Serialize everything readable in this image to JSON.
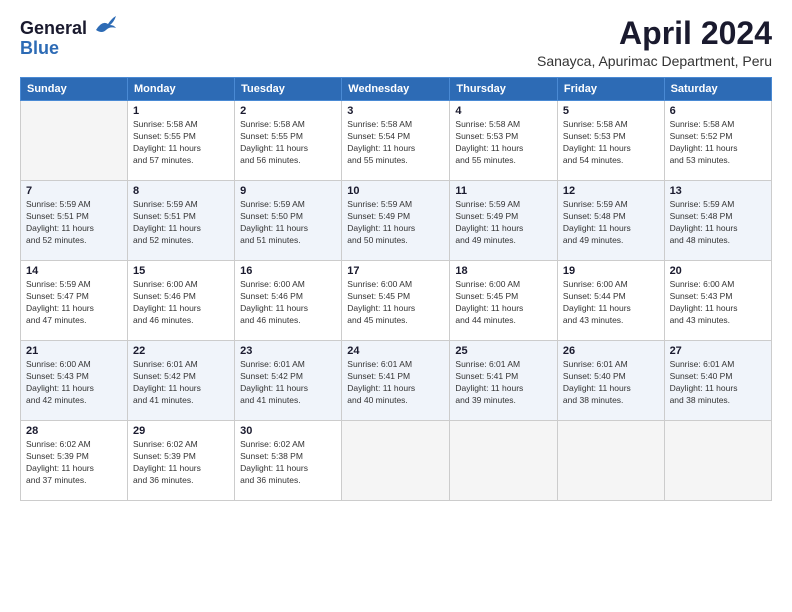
{
  "logo": {
    "general": "General",
    "blue": "Blue"
  },
  "title": {
    "month_year": "April 2024",
    "location": "Sanayca, Apurimac Department, Peru"
  },
  "headers": [
    "Sunday",
    "Monday",
    "Tuesday",
    "Wednesday",
    "Thursday",
    "Friday",
    "Saturday"
  ],
  "weeks": [
    [
      {
        "day": "",
        "info": ""
      },
      {
        "day": "1",
        "info": "Sunrise: 5:58 AM\nSunset: 5:55 PM\nDaylight: 11 hours\nand 57 minutes."
      },
      {
        "day": "2",
        "info": "Sunrise: 5:58 AM\nSunset: 5:55 PM\nDaylight: 11 hours\nand 56 minutes."
      },
      {
        "day": "3",
        "info": "Sunrise: 5:58 AM\nSunset: 5:54 PM\nDaylight: 11 hours\nand 55 minutes."
      },
      {
        "day": "4",
        "info": "Sunrise: 5:58 AM\nSunset: 5:53 PM\nDaylight: 11 hours\nand 55 minutes."
      },
      {
        "day": "5",
        "info": "Sunrise: 5:58 AM\nSunset: 5:53 PM\nDaylight: 11 hours\nand 54 minutes."
      },
      {
        "day": "6",
        "info": "Sunrise: 5:58 AM\nSunset: 5:52 PM\nDaylight: 11 hours\nand 53 minutes."
      }
    ],
    [
      {
        "day": "7",
        "info": "Sunrise: 5:59 AM\nSunset: 5:51 PM\nDaylight: 11 hours\nand 52 minutes."
      },
      {
        "day": "8",
        "info": "Sunrise: 5:59 AM\nSunset: 5:51 PM\nDaylight: 11 hours\nand 52 minutes."
      },
      {
        "day": "9",
        "info": "Sunrise: 5:59 AM\nSunset: 5:50 PM\nDaylight: 11 hours\nand 51 minutes."
      },
      {
        "day": "10",
        "info": "Sunrise: 5:59 AM\nSunset: 5:49 PM\nDaylight: 11 hours\nand 50 minutes."
      },
      {
        "day": "11",
        "info": "Sunrise: 5:59 AM\nSunset: 5:49 PM\nDaylight: 11 hours\nand 49 minutes."
      },
      {
        "day": "12",
        "info": "Sunrise: 5:59 AM\nSunset: 5:48 PM\nDaylight: 11 hours\nand 49 minutes."
      },
      {
        "day": "13",
        "info": "Sunrise: 5:59 AM\nSunset: 5:48 PM\nDaylight: 11 hours\nand 48 minutes."
      }
    ],
    [
      {
        "day": "14",
        "info": "Sunrise: 5:59 AM\nSunset: 5:47 PM\nDaylight: 11 hours\nand 47 minutes."
      },
      {
        "day": "15",
        "info": "Sunrise: 6:00 AM\nSunset: 5:46 PM\nDaylight: 11 hours\nand 46 minutes."
      },
      {
        "day": "16",
        "info": "Sunrise: 6:00 AM\nSunset: 5:46 PM\nDaylight: 11 hours\nand 46 minutes."
      },
      {
        "day": "17",
        "info": "Sunrise: 6:00 AM\nSunset: 5:45 PM\nDaylight: 11 hours\nand 45 minutes."
      },
      {
        "day": "18",
        "info": "Sunrise: 6:00 AM\nSunset: 5:45 PM\nDaylight: 11 hours\nand 44 minutes."
      },
      {
        "day": "19",
        "info": "Sunrise: 6:00 AM\nSunset: 5:44 PM\nDaylight: 11 hours\nand 43 minutes."
      },
      {
        "day": "20",
        "info": "Sunrise: 6:00 AM\nSunset: 5:43 PM\nDaylight: 11 hours\nand 43 minutes."
      }
    ],
    [
      {
        "day": "21",
        "info": "Sunrise: 6:00 AM\nSunset: 5:43 PM\nDaylight: 11 hours\nand 42 minutes."
      },
      {
        "day": "22",
        "info": "Sunrise: 6:01 AM\nSunset: 5:42 PM\nDaylight: 11 hours\nand 41 minutes."
      },
      {
        "day": "23",
        "info": "Sunrise: 6:01 AM\nSunset: 5:42 PM\nDaylight: 11 hours\nand 41 minutes."
      },
      {
        "day": "24",
        "info": "Sunrise: 6:01 AM\nSunset: 5:41 PM\nDaylight: 11 hours\nand 40 minutes."
      },
      {
        "day": "25",
        "info": "Sunrise: 6:01 AM\nSunset: 5:41 PM\nDaylight: 11 hours\nand 39 minutes."
      },
      {
        "day": "26",
        "info": "Sunrise: 6:01 AM\nSunset: 5:40 PM\nDaylight: 11 hours\nand 38 minutes."
      },
      {
        "day": "27",
        "info": "Sunrise: 6:01 AM\nSunset: 5:40 PM\nDaylight: 11 hours\nand 38 minutes."
      }
    ],
    [
      {
        "day": "28",
        "info": "Sunrise: 6:02 AM\nSunset: 5:39 PM\nDaylight: 11 hours\nand 37 minutes."
      },
      {
        "day": "29",
        "info": "Sunrise: 6:02 AM\nSunset: 5:39 PM\nDaylight: 11 hours\nand 36 minutes."
      },
      {
        "day": "30",
        "info": "Sunrise: 6:02 AM\nSunset: 5:38 PM\nDaylight: 11 hours\nand 36 minutes."
      },
      {
        "day": "",
        "info": ""
      },
      {
        "day": "",
        "info": ""
      },
      {
        "day": "",
        "info": ""
      },
      {
        "day": "",
        "info": ""
      }
    ]
  ]
}
